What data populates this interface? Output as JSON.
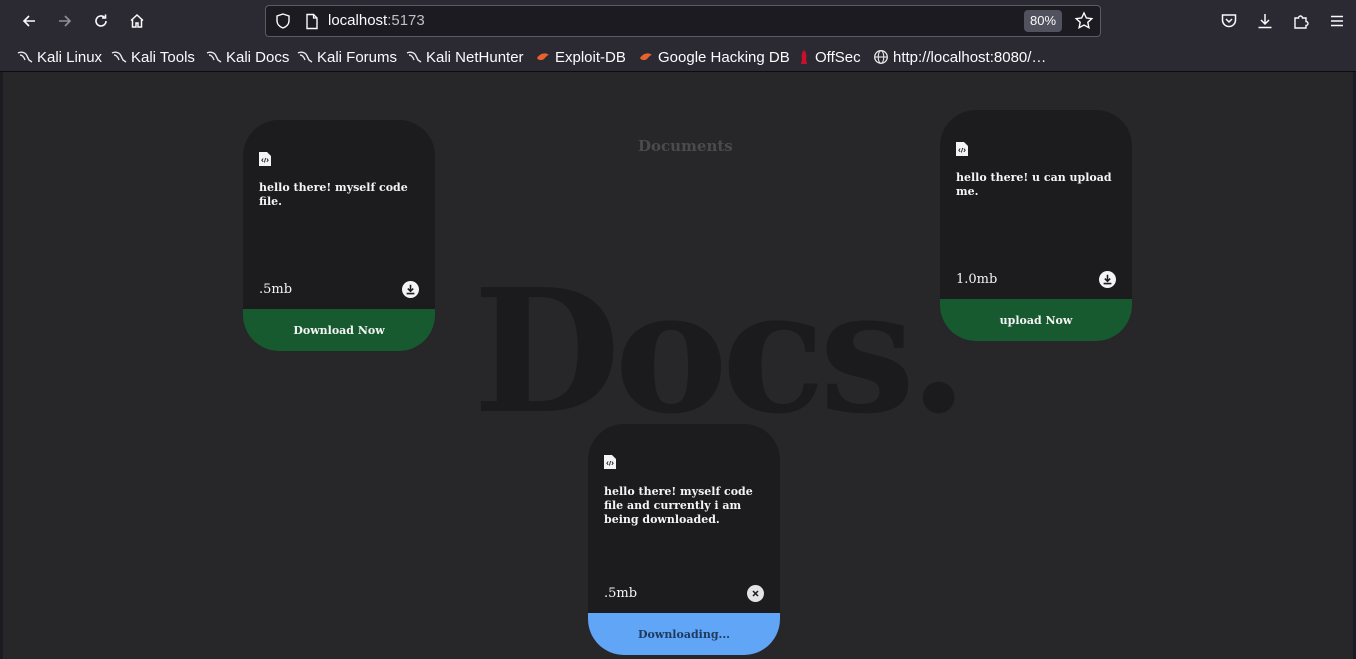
{
  "browser": {
    "url_host": "localhost",
    "url_port": ":5173",
    "zoom": "80%",
    "icons": [
      "back-arrow-icon",
      "forward-arrow-icon",
      "reload-icon",
      "home-icon",
      "shield-icon",
      "page-icon",
      "star-icon",
      "pocket-icon",
      "download-icon",
      "extensions-icon",
      "menu-icon"
    ]
  },
  "bookmarks": [
    {
      "label": "Kali Linux",
      "icon": "kali-dragon-icon"
    },
    {
      "label": "Kali Tools",
      "icon": "kali-dragon-icon"
    },
    {
      "label": "Kali Docs",
      "icon": "kali-dragon-icon"
    },
    {
      "label": "Kali Forums",
      "icon": "kali-dragon-icon"
    },
    {
      "label": "Kali NetHunter",
      "icon": "kali-dragon-icon"
    },
    {
      "label": "Exploit-DB",
      "icon": "exploit-db-icon"
    },
    {
      "label": "Google Hacking DB",
      "icon": "exploit-db-icon"
    },
    {
      "label": "OffSec",
      "icon": "offsec-icon"
    },
    {
      "label": "http://localhost:8080/…",
      "icon": "globe-icon"
    }
  ],
  "page": {
    "background_word": "Docs.",
    "title": "Documents",
    "cards": [
      {
        "description": "hello there! myself code file.",
        "size": ".5mb",
        "action_icon": "download-icon",
        "button_label": "Download Now",
        "button_color": "#185a30"
      },
      {
        "description": "hello there! u can upload me.",
        "size": "1.0mb",
        "action_icon": "download-icon",
        "button_label": "upload Now",
        "button_color": "#185a30"
      },
      {
        "description": "hello there! myself code file and currently i am being downloaded.",
        "size": ".5mb",
        "action_icon": "close-icon",
        "button_label": "Downloading...",
        "button_color": "#60a5f6"
      }
    ]
  }
}
